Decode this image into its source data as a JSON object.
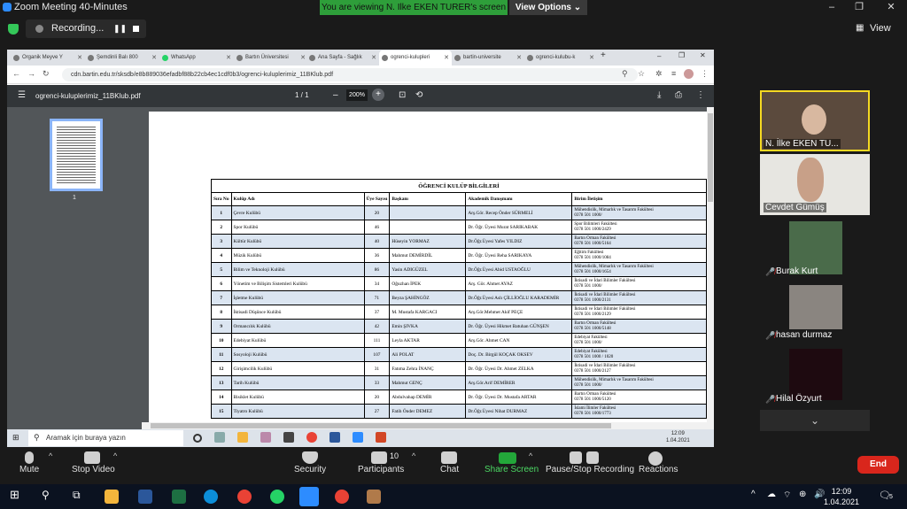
{
  "zoom": {
    "title": "Zoom Meeting 40-Minutes",
    "viewing": "You are viewing N. Ilke EKEN TURER's screen",
    "view_options": "View Options ⌄",
    "recording": "Recording...",
    "view": "View",
    "minimize": "–",
    "restore": "❐",
    "close": "✕"
  },
  "browser": {
    "tabs": [
      "Organik Meyve Y",
      "Şemdinli Balı 800",
      "WhatsApp",
      "Bartın Üniversitesi",
      "Ana Sayfa - Sağlık",
      "ogrenci-kulupleri",
      "bartin-universite",
      "ogrenci-kulubu-k"
    ],
    "new_tab": "+",
    "url": "cdn.bartin.edu.tr/sksdb/e8b889036efadbf88b22cb4ec1cdf0b3/ogrenci-kuluplerimiz_11BKlub.pdf"
  },
  "pdf": {
    "filename": "ogrenci-kuluplerimiz_11BKlub.pdf",
    "page": "1 / 1",
    "zoom": "200%",
    "thumb_page": "1"
  },
  "table": {
    "title": "ÖĞRENCİ KULÜP BİLGİLERİ",
    "headers": [
      "Sıra No",
      "Kulüp Adı",
      "Üye Sayısı",
      "Başkanı",
      "Akademik Danışmanı",
      "Birim İletişim"
    ],
    "rows": [
      [
        "1",
        "Çevre Kulübü",
        "20",
        "",
        "Arş.Gör. Recep Önder SÜRMELİ",
        "Mühendislik, Mimarlık ve Tasarım Fakültesi\n0378 501 1000/"
      ],
      [
        "2",
        "Spor Kulübü",
        "46",
        "",
        "Dr. Öğr. Üyesi Murat SARIKABAK",
        "Spor Bilimleri Fakültesi\n0378 501 1000/2429"
      ],
      [
        "3",
        "Kültür Kulübü",
        "40",
        "Hüseyin YORMAZ",
        "Dr.Öğr.Üyesi Yafes YILDIZ",
        "Bartın Orman Fakültesi\n0378 501 1000/5164"
      ],
      [
        "4",
        "Müzik Kulübü",
        "36",
        "Mahmut DEMİRDİL",
        "Dr. Öğr. Üyesi Reha SARIKAYA",
        "Eğitim Fakültesi\n0378 501 1000/1084"
      ],
      [
        "5",
        "Bilim ve Teknoloji Kulübü",
        "86",
        "Yasin ADIGÜZEL",
        "Dr.Öğr.Üyesi Abid USTAOĞLU",
        "Mühendislik, Mimarlık ve Tasarım Fakültesi\n0378 501 1000/1654"
      ],
      [
        "6",
        "Yönetim ve Bilişim Sistemleri Kulübü",
        "34",
        "Oğuzhan İPEK",
        "Arş. Gör. Ahmet AYAZ",
        "İktisadi ve İdari Bilimler Fakültesi\n0378 501 1000/"
      ],
      [
        "7",
        "İşletme Kulübü",
        "71",
        "Beyza ŞAHİNGÖZ",
        "Dr.Öğr.Üyesi Aslı ÇİLLİOĞLU KARADEMİR",
        "İktisadi ve İdari Bilimler Fakültesi\n0378 501 1000/2131"
      ],
      [
        "8",
        "İktisadi Düşünce Kulübü",
        "37",
        "M. Mustafa KARGACI",
        "Arş.Gör.Mehmet Akif PEÇE",
        "İktisadi ve İdari Bilimler Fakültesi\n0378 501 1000/2129"
      ],
      [
        "9",
        "Ormancılık Kulübü",
        "42",
        "Emin ŞIVKA",
        "Dr. Öğr. Üyesi Hikmet Batuhan GÜNŞEN",
        "Bartın Orman Fakültesi\n0378 501 1000/5148"
      ],
      [
        "10",
        "Edebiyat Kulübü",
        "111",
        "Leyla AKTAR",
        "Arş.Gör. Ahmet CAN",
        "Edebiyat Fakültesi\n0378 501 1000/"
      ],
      [
        "11",
        "Sosyoloji Kulübü",
        "107",
        "Ali POLAT",
        "Doç. Dr. Birgül KOÇAK OKSEV",
        "Edebiyat Fakültesi\n0378 501 1000 / 1020"
      ],
      [
        "12",
        "Girişimcilik Kulübü",
        "31",
        "Fatıma Zehra İNANÇ",
        "Dr. Öğr. Üyesi Dr. Ahmet ZELKA",
        "İktisadi ve İdari Bilimler Fakültesi\n0378 501 1000/2127"
      ],
      [
        "13",
        "Tarih Kulübü",
        "33",
        "Mahmut GENÇ",
        "Arş.Gör.Arif DEMİRER",
        "Mühendislik, Mimarlık ve Tasarım Fakültesi\n0378 501 1000/"
      ],
      [
        "14",
        "Bisiklet Kulübü",
        "20",
        "Abdulvahap DEMİR",
        "Dr. Öğr. Üyesi Dr. Mustafa ARTAR",
        "Bartın Orman Fakültesi\n0378 501 1000/5120"
      ],
      [
        "15",
        "Tiyatro Kulübü",
        "27",
        "Fatih Önder DEMEZ",
        "Dr.Öğr.Üyesi Nihat DURMAZ",
        "İslami İlimler Fakültesi\n0378 501 1000/1773"
      ]
    ]
  },
  "inner_taskbar": {
    "search": "Aramak için buraya yazın",
    "time": "12:09",
    "date": "1.04.2021"
  },
  "participants": [
    {
      "name": "N. İlke EKEN TU...",
      "muted": false
    },
    {
      "name": "Cevdet Gümüş",
      "muted": false
    },
    {
      "name": "Burak Kurt",
      "muted": true
    },
    {
      "name": "hasan durmaz",
      "muted": true
    },
    {
      "name": "Hilal Özyurt",
      "muted": true
    }
  ],
  "more_participants": "⌄",
  "controls": {
    "mute": "Mute",
    "stop_video": "Stop Video",
    "security": "Security",
    "participants": "Participants",
    "participants_count": "10",
    "chat": "Chat",
    "share": "Share Screen",
    "pause": "Pause/Stop Recording",
    "reactions": "Reactions",
    "end": "End"
  },
  "taskbar": {
    "time": "12:09",
    "date": "1.04.2021",
    "notif": "5"
  }
}
